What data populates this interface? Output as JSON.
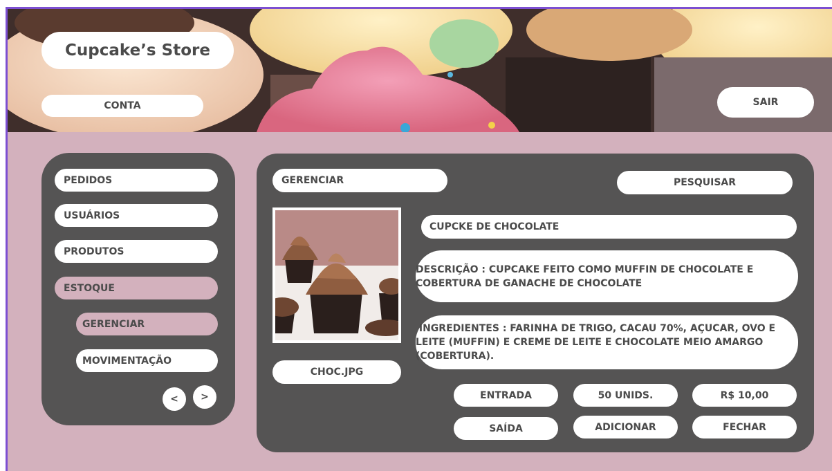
{
  "header": {
    "title": "Cupcake’s Store",
    "account_label": "CONTA",
    "logout_label": "SAIR"
  },
  "sidebar": {
    "items": [
      {
        "label": "PEDIDOS"
      },
      {
        "label": "USUÁRIOS"
      },
      {
        "label": "PRODUTOS"
      },
      {
        "label": "ESTOQUE"
      }
    ],
    "subitems": [
      {
        "label": "GERENCIAR"
      },
      {
        "label": "MOVIMENTAÇÃO"
      }
    ],
    "prev_label": "<",
    "next_label": ">"
  },
  "main": {
    "section_label": "GERENCIAR",
    "search_label": "PESQUISAR",
    "image_filename": "CHOC.JPG",
    "product_name": "CUPCKE DE CHOCOLATE",
    "description": "DESCRIÇÃO : CUPCAKE FEITO COMO MUFFIN DE CHOCOLATE E COBERTURA DE GANACHE DE CHOCOLATE",
    "ingredients": " INGREDIENTES : FARINHA DE TRIGO, CACAU 70%, AÇUCAR, OVO E LEITE (MUFFIN) E CREME DE LEITE E CHOCOLATE MEIO AMARGO (COBERTURA).",
    "actions": {
      "entry": "ENTRADA",
      "quantity": "50 UNIDS.",
      "price": "R$ 10,00",
      "exit": "SAÍDA",
      "add": "ADICIONAR",
      "close": "FECHAR"
    }
  },
  "colors": {
    "background": "#d3b1bd",
    "panel": "#555454",
    "active_item": "#d3b1bd",
    "text": "#4b4b4b",
    "frame_border": "#7c4fd1"
  }
}
